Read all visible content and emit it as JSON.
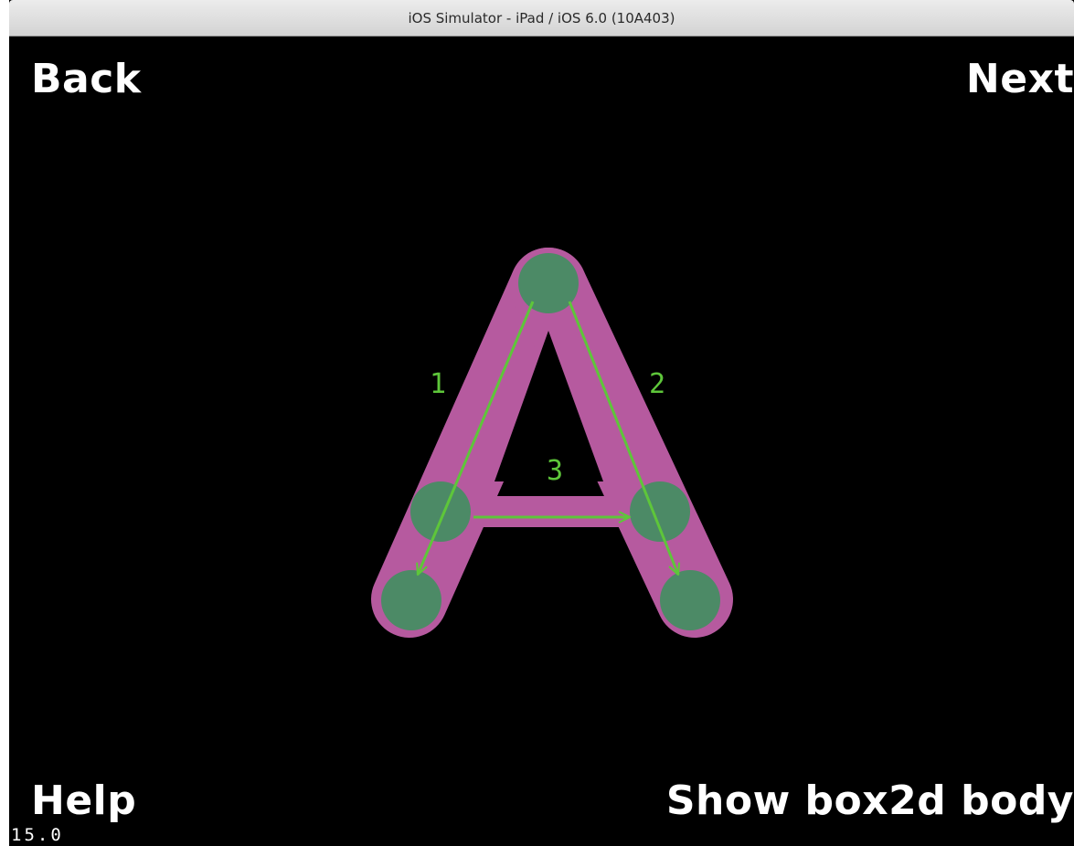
{
  "window": {
    "title": "iOS Simulator - iPad / iOS 6.0 (10A403)"
  },
  "menu": {
    "back_label": "Back",
    "next_label": "Next",
    "help_label": "Help",
    "show_body_label": "Show box2d body"
  },
  "stats": {
    "fps": "15.0"
  },
  "letter": {
    "character": "A",
    "stroke_numbers": [
      "1",
      "2",
      "3"
    ]
  },
  "colors": {
    "letter_fill": "#b65a9f",
    "point_fill": "#4c8a66",
    "arrow": "#5ec63a",
    "background": "#000000",
    "label": "#ffffff"
  }
}
